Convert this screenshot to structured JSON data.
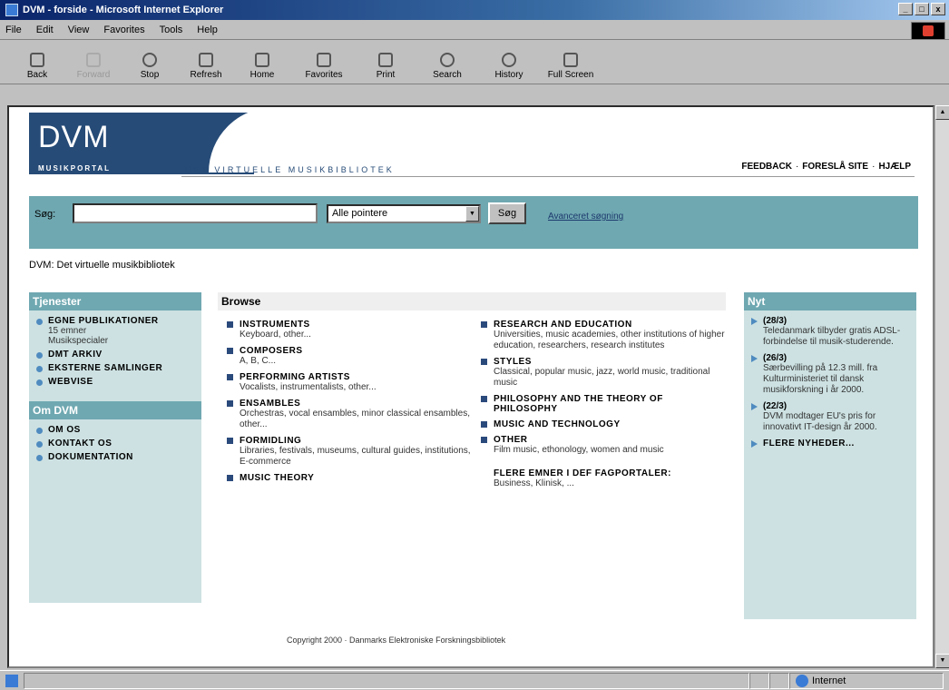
{
  "window": {
    "title": "DVM - forside - Microsoft Internet Explorer",
    "controls": [
      "_",
      "□",
      "x"
    ]
  },
  "menu": [
    "File",
    "Edit",
    "View",
    "Favorites",
    "Tools",
    "Help"
  ],
  "toolbar": {
    "back": "Back",
    "forward": "Forward",
    "stop": "Stop",
    "refresh": "Refresh",
    "home": "Home",
    "favorites": "Favorites",
    "print": "Print",
    "search": "Search",
    "history": "History",
    "fullscreen": "Full Screen"
  },
  "header": {
    "logo": "DVM",
    "logo_sub": "MUSIKPORTAL",
    "tagline": "DET VIRTUELLE MUSIKBIBLIOTEK",
    "links": [
      "FEEDBACK",
      "FORESLÅ SITE",
      "HJÆLP"
    ],
    "link_sep": "·"
  },
  "search": {
    "label": "Søg:",
    "value": "",
    "select_value": "Alle pointere",
    "button": "Søg",
    "advanced": "Avanceret søgning"
  },
  "breadcrumb": "DVM: Det virtuelle musikbibliotek",
  "left": {
    "services_title": "Tjenester",
    "services": [
      {
        "title": "EGNE PUBLIKATIONER",
        "sub1": "15 emner",
        "sub2": "Musikspecialer"
      },
      {
        "title": "DMT ARKIV"
      },
      {
        "title": "EKSTERNE SAMLINGER"
      },
      {
        "title": "WEBVISE"
      }
    ],
    "about_title": "Om DVM",
    "about": [
      "OM OS",
      "KONTAKT OS",
      "DOKUMENTATION"
    ]
  },
  "browse": {
    "title": "Browse",
    "col1": [
      {
        "title": "INSTRUMENTS",
        "desc": "Keyboard, other..."
      },
      {
        "title": "COMPOSERS",
        "desc": "A, B, C..."
      },
      {
        "title": "PERFORMING ARTISTS",
        "desc": "Vocalists, instrumentalists, other..."
      },
      {
        "title": "ENSAMBLES",
        "desc": "Orchestras, vocal ensambles, minor classical ensambles, other..."
      },
      {
        "title": "FORMIDLING",
        "desc": "Libraries, festivals, museums, cultural guides, institutions, E-commerce"
      },
      {
        "title": "MUSIC THEORY",
        "desc": ""
      }
    ],
    "col2": [
      {
        "title": "RESEARCH AND EDUCATION",
        "desc": "Universities, music academies, other institutions of higher education, researchers, research institutes"
      },
      {
        "title": "STYLES",
        "desc": "Classical, popular music, jazz, world music, traditional music"
      },
      {
        "title": "PHILOSOPHY AND THE THEORY OF PHILOSOPHY",
        "desc": ""
      },
      {
        "title": "MUSIC AND TECHNOLOGY",
        "desc": ""
      },
      {
        "title": "OTHER",
        "desc": "Film music, ethonology, women and music"
      }
    ],
    "more_title": "FLERE EMNER I DEF FAGPORTALER:",
    "more_desc": "Business, Klinisk, ..."
  },
  "news": {
    "title": "Nyt",
    "items": [
      {
        "date": "(28/3)",
        "text": "Teledanmark tilbyder gratis ADSL-forbindelse til musik-studerende."
      },
      {
        "date": "(26/3)",
        "text": "Særbevilling på 12.3 mill. fra Kulturministeriet til dansk musikforskning i år 2000."
      },
      {
        "date": "(22/3)",
        "text": "DVM modtager EU's pris for innovativt IT-design år 2000."
      }
    ],
    "more": "FLERE NYHEDER..."
  },
  "copyright": "Copyright 2000 · Danmarks Elektroniske Forskningsbibliotek",
  "status": {
    "zone": "Internet"
  }
}
